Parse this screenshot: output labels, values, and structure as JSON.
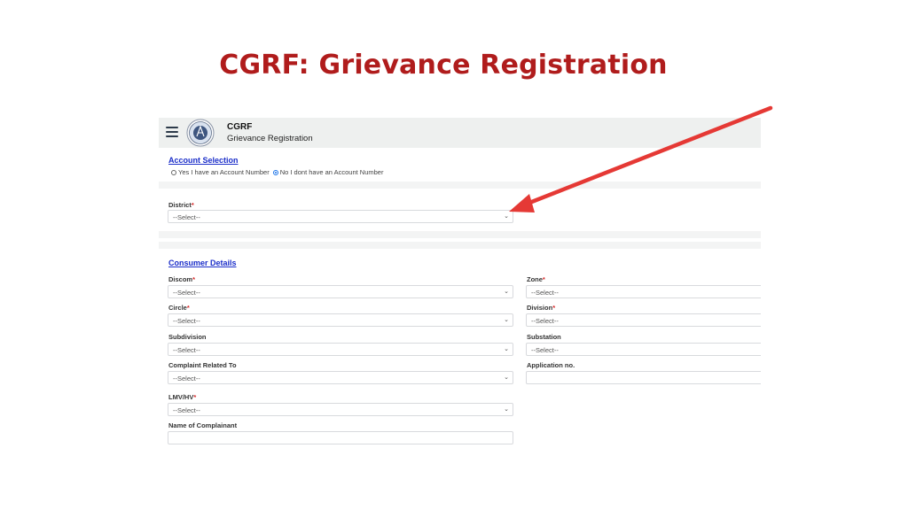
{
  "heading": "CGRF: Grievance Registration",
  "app": {
    "name": "CGRF",
    "subtitle": "Grievance Registration"
  },
  "account_selection": {
    "title": "Account Selection",
    "options": [
      {
        "label": "Yes I have an Account Number",
        "selected": false
      },
      {
        "label": "No I dont have an Account Number",
        "selected": true
      }
    ]
  },
  "district": {
    "label": "District",
    "value": "--Select--"
  },
  "consumer_details": {
    "title": "Consumer Details",
    "discom": {
      "label": "Discom",
      "value": "--Select--"
    },
    "zone": {
      "label": "Zone",
      "value": "--Select--"
    },
    "circle": {
      "label": "Circle",
      "value": "--Select--"
    },
    "division": {
      "label": "Division",
      "value": "--Select--"
    },
    "subdivision": {
      "label": "Subdivision",
      "value": "--Select--"
    },
    "substation": {
      "label": "Substation",
      "value": "--Select--"
    },
    "complaint_related": {
      "label": "Complaint Related To",
      "value": "--Select--"
    },
    "application_no": {
      "label": "Application no.",
      "value": ""
    },
    "lmv_hv": {
      "label": "LMV/HV",
      "value": "--Select--"
    },
    "complainant_name": {
      "label": "Name of Complainant",
      "value": ""
    }
  },
  "required_marker": "*",
  "chevron": "⌄",
  "colors": {
    "heading": "#b01c1c",
    "link": "#1b2ec9",
    "arrow": "#e53935",
    "header_bg": "#eef0ef"
  }
}
